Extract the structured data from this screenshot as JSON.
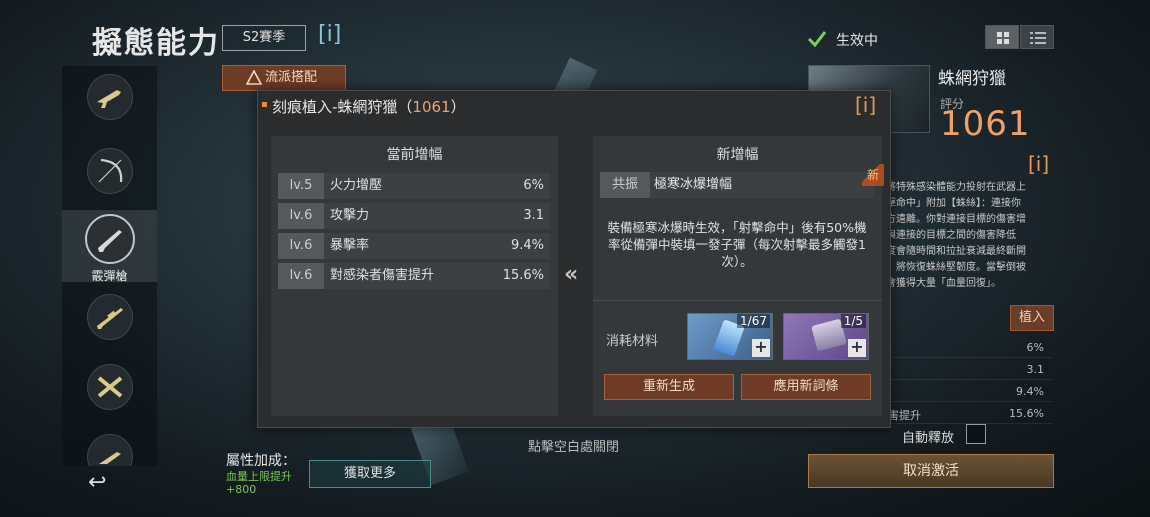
{
  "header": {
    "title": "擬態能力",
    "season": "S2賽季",
    "info_icon": "[i]",
    "active_status": "生效中"
  },
  "flow_button": "流派搭配",
  "weapon_rail": {
    "active_label": "霰彈槍"
  },
  "back_icon": "↩",
  "attributes": {
    "title": "屬性加成：",
    "value": "血量上限提升 +800",
    "get_more": "獲取更多"
  },
  "close_hint": "點擊空白處關閉",
  "detail": {
    "name": "蛛網狩獵",
    "score_label": "評分",
    "score": "1061",
    "info_icon": "[i]",
    "desc_lines": [
      "將特殊感染體能力投射在武器上",
      "擊命中」附加【蛛絲】：連接你",
      "方遠離。你對連接目標的傷害增",
      "與連接的目標之間的傷害降低",
      "度會隨時間和拉扯衰減最終斷開",
      "」將恢復蛛絲堅韌度。當擊倒被",
      "會獲得大量「血量回復」。"
    ],
    "implant": "植入",
    "stats": [
      {
        "name": "",
        "value": "6%"
      },
      {
        "name": "",
        "value": "3.1"
      },
      {
        "name": "",
        "value": "9.4%"
      },
      {
        "name": "害提升",
        "value": "15.6%"
      }
    ],
    "auto_release": "自動釋放",
    "cancel": "取消激活"
  },
  "dialog": {
    "title": "刻痕植入-蛛網狩獵（",
    "title_num": "1061",
    "title_end": "）",
    "info_icon": "[i]",
    "current": {
      "title": "當前增幅",
      "rows": [
        {
          "lv": "lv.5",
          "name": "火力增壓",
          "value": "6%"
        },
        {
          "lv": "lv.6",
          "name": "攻擊力",
          "value": "3.1"
        },
        {
          "lv": "lv.6",
          "name": "暴擊率",
          "value": "9.4%"
        },
        {
          "lv": "lv.6",
          "name": "對感染者傷害提升",
          "value": "15.6%"
        }
      ]
    },
    "arrow": "«",
    "new": {
      "title": "新增幅",
      "tag": "共振",
      "name": "極寒冰爆增幅",
      "badge": "新",
      "desc": "裝備極寒冰爆時生效，「射擊命中」後有50%機率從備彈中裝填一發子彈（每次射擊最多觸發1次）。"
    },
    "materials": {
      "label": "消耗材料",
      "items": [
        {
          "count": "1/67",
          "plus": "+"
        },
        {
          "count": "1/5",
          "plus": "+"
        }
      ]
    },
    "regen": "重新生成",
    "apply": "應用新詞條"
  }
}
